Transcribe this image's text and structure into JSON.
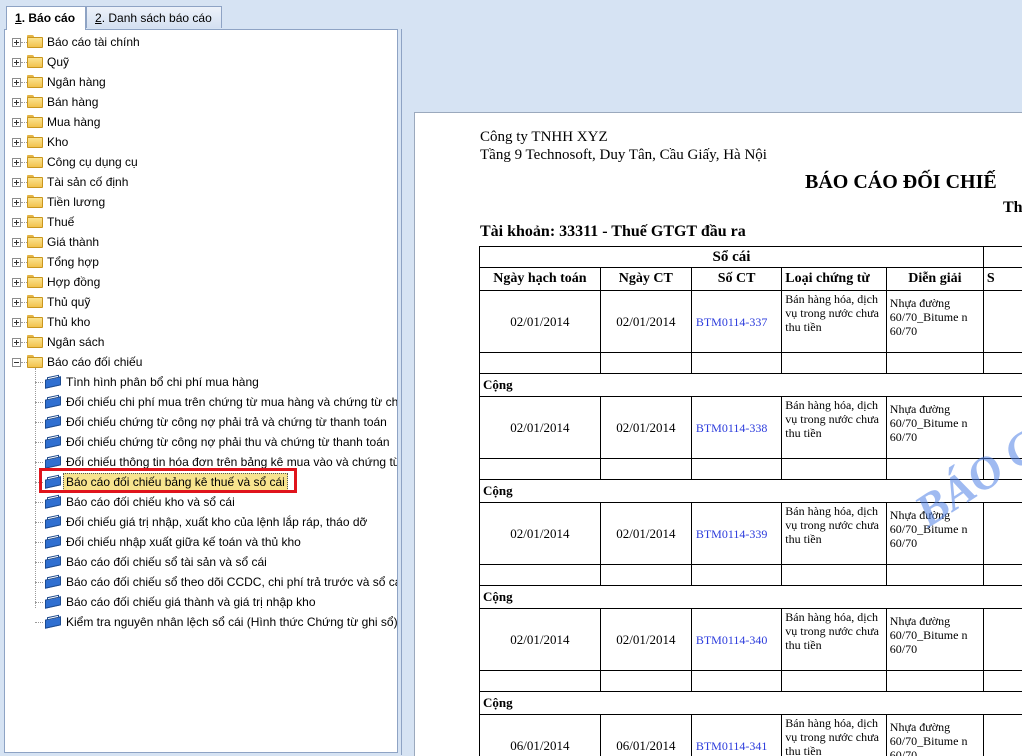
{
  "tabs": [
    {
      "prefix": "1",
      "label": ". Báo cáo",
      "active": true
    },
    {
      "prefix": "2",
      "label": ". Danh sách báo cáo",
      "active": false
    }
  ],
  "tree": {
    "folders": [
      "Báo cáo tài chính",
      "Quỹ",
      "Ngân hàng",
      "Bán hàng",
      "Mua hàng",
      "Kho",
      "Công cụ dụng cụ",
      "Tài sản cố định",
      "Tiền lương",
      "Thuế",
      "Giá thành",
      "Tổng hợp",
      "Hợp đồng",
      "Thủ quỹ",
      "Thủ kho",
      "Ngân sách",
      "Báo cáo đối chiếu"
    ],
    "children": [
      "Tình hình phân bổ chi phí mua hàng",
      "Đối chiếu chi phí mua trên chứng từ mua hàng và chứng từ chi phí",
      "Đối chiếu chứng từ công nợ phải trả và chứng từ thanh toán",
      "Đối chiếu chứng từ công nợ phải thu và chứng từ thanh toán",
      "Đối chiếu thông tin hóa đơn trên bảng kê mua vào và chứng từ",
      "Báo cáo đối chiếu bảng kê thuế và sổ cái",
      "Báo cáo đối chiếu kho và sổ cái",
      "Đối chiếu giá trị nhập, xuất kho của lệnh lắp ráp, tháo dỡ",
      "Đối chiếu nhập xuất giữa kế toán và thủ kho",
      "Báo cáo đối chiếu sổ tài sản và sổ cái",
      "Báo cáo đối chiếu sổ theo dõi CCDC, chi phí trả trước và sổ cái",
      "Báo cáo đối chiếu giá thành và giá trị nhập kho",
      "Kiểm tra nguyên nhân lệch sổ cái (Hình thức Chứng từ ghi sổ)"
    ],
    "selected_child_index": 5
  },
  "report": {
    "company": "Công ty TNHH XYZ",
    "address": "Tầng 9 Technosoft, Duy Tân, Cầu Giấy, Hà Nội",
    "title": "BÁO CÁO ĐỐI CHIẾ",
    "subtitle": "Th",
    "account": "Tài khoản: 33311 - Thuế GTGT đầu ra",
    "group_header": "Sổ cái",
    "columns": [
      "Ngày hạch toán",
      "Ngày CT",
      "Số CT",
      "Loại chứng từ",
      "Diễn giải",
      "S"
    ],
    "sum_label": "Cộng",
    "rows": [
      {
        "posting_date": "02/01/2014",
        "doc_date": "02/01/2014",
        "doc_no": "BTM0114-337",
        "doc_type": "Bán hàng hóa, dịch vụ trong nước chưa thu tiền",
        "desc": "Nhựa đường 60/70_Bitume n 60/70"
      },
      {
        "posting_date": "02/01/2014",
        "doc_date": "02/01/2014",
        "doc_no": "BTM0114-338",
        "doc_type": "Bán hàng hóa, dịch vụ trong nước chưa thu tiền",
        "desc": "Nhựa đường 60/70_Bitume n 60/70"
      },
      {
        "posting_date": "02/01/2014",
        "doc_date": "02/01/2014",
        "doc_no": "BTM0114-339",
        "doc_type": "Bán hàng hóa, dịch vụ trong nước chưa thu tiền",
        "desc": "Nhựa đường 60/70_Bitume n 60/70"
      },
      {
        "posting_date": "02/01/2014",
        "doc_date": "02/01/2014",
        "doc_no": "BTM0114-340",
        "doc_type": "Bán hàng hóa, dịch vụ trong nước chưa thu tiền",
        "desc": "Nhựa đường 60/70_Bitume n 60/70"
      },
      {
        "posting_date": "06/01/2014",
        "doc_date": "06/01/2014",
        "doc_no": "BTM0114-341",
        "doc_type": "Bán hàng hóa, dịch vụ trong nước chưa thu tiền",
        "desc": "Nhựa đường 60/70_Bitume n 60/70"
      }
    ],
    "watermark": "BÁO C"
  }
}
